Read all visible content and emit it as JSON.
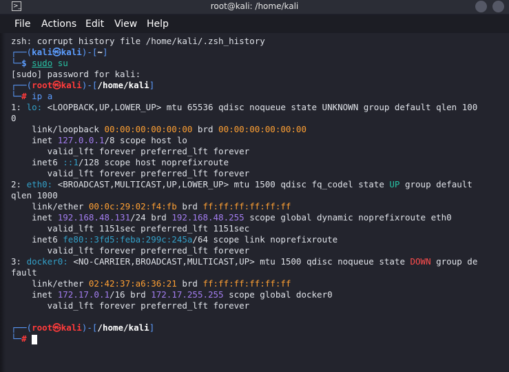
{
  "window": {
    "title": "root@kali: /home/kali"
  },
  "menu": {
    "items": [
      "File",
      "Actions",
      "Edit",
      "View",
      "Help"
    ]
  },
  "terminal": {
    "l1": "zsh: corrupt history file /home/kali/.zsh_history",
    "p1": {
      "corner": "┌──(",
      "user": "kali",
      "at": "㉿",
      "host": "kali",
      "mid": ")-[",
      "path": "~",
      "end": "]"
    },
    "p1b": {
      "corner": "└─",
      "sym": "$",
      "space": " ",
      "cmd": "sudo",
      "rest": " su"
    },
    "l_pw": "[sudo] password for kali:",
    "p2": {
      "corner": "┌──(",
      "user": "root",
      "at": "㉿",
      "host": "kali",
      "mid": ")-[",
      "path": "/home/kali",
      "end": "]"
    },
    "p2b": {
      "corner": "└─",
      "sym": "#",
      "cmd": " ip a"
    },
    "if1": {
      "num": "1: ",
      "name": "lo:",
      "rest": " <LOOPBACK,UP,LOWER_UP> mtu 65536 qdisc noqueue state UNKNOWN group default qlen 100"
    },
    "if1_wrap": "0",
    "if1_link": {
      "pre": "    link/loopback ",
      "mac": "00:00:00:00:00:00",
      "mid": " brd ",
      "brd": "00:00:00:00:00:00"
    },
    "if1_inet": {
      "pre": "    inet ",
      "ip": "127.0.0.1",
      "rest": "/8 scope host lo"
    },
    "if1_valid1": "       valid_lft forever preferred_lft forever",
    "if1_inet6": {
      "pre": "    inet6 ",
      "ip": "::1",
      "rest": "/128 scope host noprefixroute"
    },
    "if1_valid2": "       valid_lft forever preferred_lft forever",
    "if2": {
      "num": "2: ",
      "name": "eth0:",
      "mid": " <BROADCAST,MULTICAST,UP,LOWER_UP> mtu 1500 qdisc fq_codel state ",
      "state": "UP",
      "rest": " group default"
    },
    "if2_wrap": "qlen 1000",
    "if2_link": {
      "pre": "    link/ether ",
      "mac": "00:0c:29:02:f4:fb",
      "mid": " brd ",
      "brd": "ff:ff:ff:ff:ff:ff"
    },
    "if2_inet": {
      "pre": "    inet ",
      "ip": "192.168.48.131",
      "mid": "/24 brd ",
      "brd": "192.168.48.255",
      "rest": " scope global dynamic noprefixroute eth0"
    },
    "if2_valid1": "       valid_lft 1151sec preferred_lft 1151sec",
    "if2_inet6": {
      "pre": "    inet6 ",
      "ip": "fe80::3fd5:feba:299c:245a",
      "rest": "/64 scope link noprefixroute"
    },
    "if2_valid2": "       valid_lft forever preferred_lft forever",
    "if3": {
      "num": "3: ",
      "name": "docker0:",
      "mid": " <NO-CARRIER,BROADCAST,MULTICAST,UP> mtu 1500 qdisc noqueue state ",
      "state": "DOWN",
      "rest": " group de"
    },
    "if3_wrap": "fault",
    "if3_link": {
      "pre": "    link/ether ",
      "mac": "02:42:37:a6:36:21",
      "mid": " brd ",
      "brd": "ff:ff:ff:ff:ff:ff"
    },
    "if3_inet": {
      "pre": "    inet ",
      "ip": "172.17.0.1",
      "mid": "/16 brd ",
      "brd": "172.17.255.255",
      "rest": " scope global docker0"
    },
    "if3_valid1": "       valid_lft forever preferred_lft forever",
    "p3": {
      "corner": "┌──(",
      "user": "root",
      "at": "㉿",
      "host": "kali",
      "mid": ")-[",
      "path": "/home/kali",
      "end": "]"
    },
    "p3b": {
      "corner": "└─",
      "sym": "# "
    }
  }
}
